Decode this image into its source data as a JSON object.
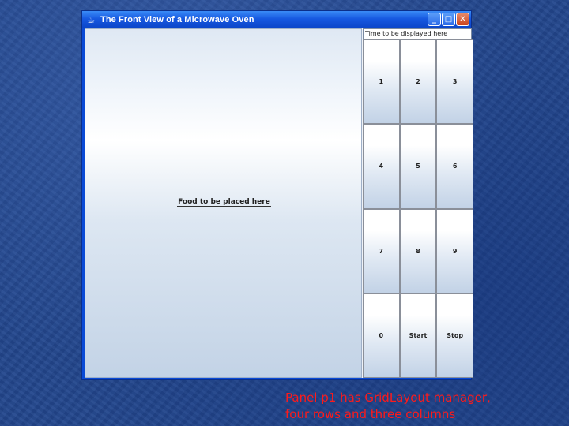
{
  "window": {
    "title": "The Front View of a Microwave Oven",
    "icon": "java-cup-icon",
    "controls": [
      "minimize",
      "maximize",
      "close"
    ]
  },
  "food_panel": {
    "label": "Food to be placed here"
  },
  "time_field": {
    "value": "Time to be displayed here"
  },
  "keypad": {
    "keys": [
      "1",
      "2",
      "3",
      "4",
      "5",
      "6",
      "7",
      "8",
      "9",
      "0",
      "Start",
      "Stop"
    ]
  },
  "caption": {
    "line1": "Panel p1 has GridLayout manager,",
    "line2": "four rows and three columns"
  },
  "colors": {
    "background": "#23478e",
    "titlebar": "#1658e0",
    "caption": "#ff1a1a"
  }
}
